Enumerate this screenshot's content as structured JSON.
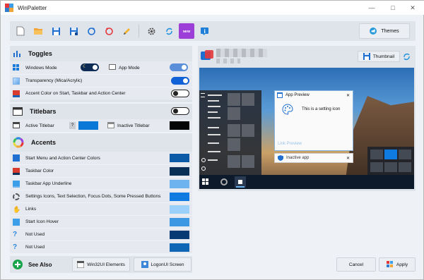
{
  "window": {
    "title": "WinPaletter",
    "minimize_glyph": "—",
    "maximize_glyph": "□",
    "close_glyph": "✕"
  },
  "toolbar": {
    "buttons": [
      {
        "name": "new-file-icon"
      },
      {
        "name": "open-folder-icon"
      },
      {
        "name": "save-icon"
      },
      {
        "name": "save-as-icon"
      },
      {
        "name": "refresh-icon"
      },
      {
        "name": "restore-default-icon"
      },
      {
        "name": "edit-pencil-icon"
      },
      {
        "name": "settings-gear-icon"
      },
      {
        "name": "sync-icon"
      },
      {
        "name": "whats-new-icon"
      },
      {
        "name": "about-info-icon"
      }
    ],
    "new_badge": "NEW",
    "themes_label": "Themes"
  },
  "toggles": {
    "title": "Toggles",
    "windows_mode": "Windows Mode",
    "app_mode": "App Mode",
    "transparency": "Transparency (Mica/Acrylic)",
    "accent_color": "Accent Color on Start, Taskbar and Action Center",
    "windows_mode_dark": true,
    "app_mode_dark": true,
    "transparency_on": true,
    "accent_on": false
  },
  "titlebars": {
    "title": "Titlebars",
    "active": "Active Titlebar",
    "inactive": "Inactive Titlebar",
    "help": "?",
    "enabled": false,
    "active_color": "#0a78d7",
    "inactive_color": "#050505"
  },
  "accents": {
    "title": "Accents",
    "items": [
      {
        "label": "Start Menu and Action Center Colors",
        "color": "#0b5aa6",
        "icon": "start-menu-icon"
      },
      {
        "label": "Taskbar Color",
        "color": "#0a2f57",
        "icon": "taskbar-icon"
      },
      {
        "label": "Taskbar App Underline",
        "color": "#6db3f0",
        "icon": "underline-icon"
      },
      {
        "label": "Settings Icons, Text Selection, Focus Dots, Some Pressed Buttons",
        "color": "#0f7ae0",
        "icon": "settings-icon"
      },
      {
        "label": "Links",
        "color": "#9bd0fa",
        "icon": "links-icon"
      },
      {
        "label": "Start Icon Hover",
        "color": "#3d98e4",
        "icon": "start-hover-icon"
      },
      {
        "label": "Not Used",
        "color": "#053a73",
        "icon": "question-icon"
      },
      {
        "label": "Not Used",
        "color": "#0f66b4",
        "icon": "question-icon"
      }
    ]
  },
  "bottom": {
    "see_also": "See Also",
    "win32ui": "Win32UI Elements",
    "logonui": "LogonUI Screen",
    "cancel": "Cancel",
    "apply": "Apply"
  },
  "preview": {
    "thumbnail": "Thumbnail",
    "app_preview_title": "App Preview",
    "app_preview_text": "This is a setting icon",
    "link_preview": "Link Preview",
    "inactive_app": "Inactive app",
    "close_glyph": "✕"
  }
}
